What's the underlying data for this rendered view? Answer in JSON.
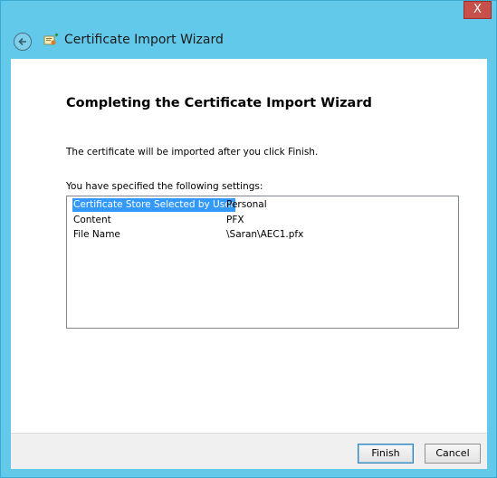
{
  "window": {
    "close_glyph": "X"
  },
  "header": {
    "title": "Certificate Import Wizard",
    "back_icon": "back-arrow-icon",
    "wizard_icon": "certificate-icon"
  },
  "main": {
    "heading": "Completing the Certificate Import Wizard",
    "description": "The certificate will be imported after you click Finish.",
    "settings_label": "You have specified the following settings:",
    "settings": [
      {
        "key": "Certificate Store Selected by User",
        "value": "Personal",
        "selected": true
      },
      {
        "key": "Content",
        "value": "PFX",
        "selected": false
      },
      {
        "key": "File Name",
        "value": "\\Saran\\AEC1.pfx",
        "selected": false
      }
    ]
  },
  "footer": {
    "finish_label": "Finish",
    "cancel_label": "Cancel"
  },
  "colors": {
    "frame": "#62c9eb",
    "close": "#c7504a",
    "selection": "#3399ff"
  }
}
